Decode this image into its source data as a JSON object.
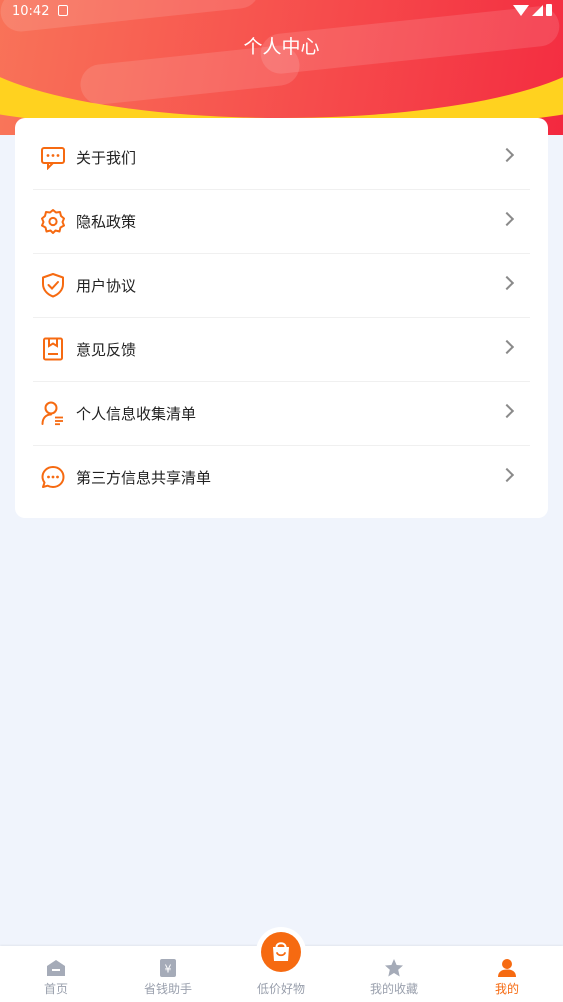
{
  "status_bar": {
    "time": "10:42"
  },
  "page_title": "个人中心",
  "menu": [
    {
      "label": "关于我们",
      "icon": "message-dots-icon"
    },
    {
      "label": "隐私政策",
      "icon": "gear-icon"
    },
    {
      "label": "用户协议",
      "icon": "shield-check-icon"
    },
    {
      "label": "意见反馈",
      "icon": "feedback-bookmark-icon"
    },
    {
      "label": "个人信息收集清单",
      "icon": "person-list-icon"
    },
    {
      "label": "第三方信息共享清单",
      "icon": "chat-bubble-icon"
    }
  ],
  "tabbar": {
    "items": [
      {
        "label": "首页",
        "icon": "home-icon",
        "active": false
      },
      {
        "label": "省钱助手",
        "icon": "yen-tag-icon",
        "active": false
      },
      {
        "label": "低价好物",
        "icon": "shopping-bag-icon",
        "active": false
      },
      {
        "label": "我的收藏",
        "icon": "star-icon",
        "active": false
      },
      {
        "label": "我的",
        "icon": "person-icon",
        "active": true
      }
    ]
  },
  "colors": {
    "accent": "#f66a11",
    "header_red": "#f3283f",
    "header_orange": "#f9785a",
    "header_yellow": "#ffd21f",
    "inactive_tab": "#9aa0ad",
    "background": "#f0f4fc"
  }
}
